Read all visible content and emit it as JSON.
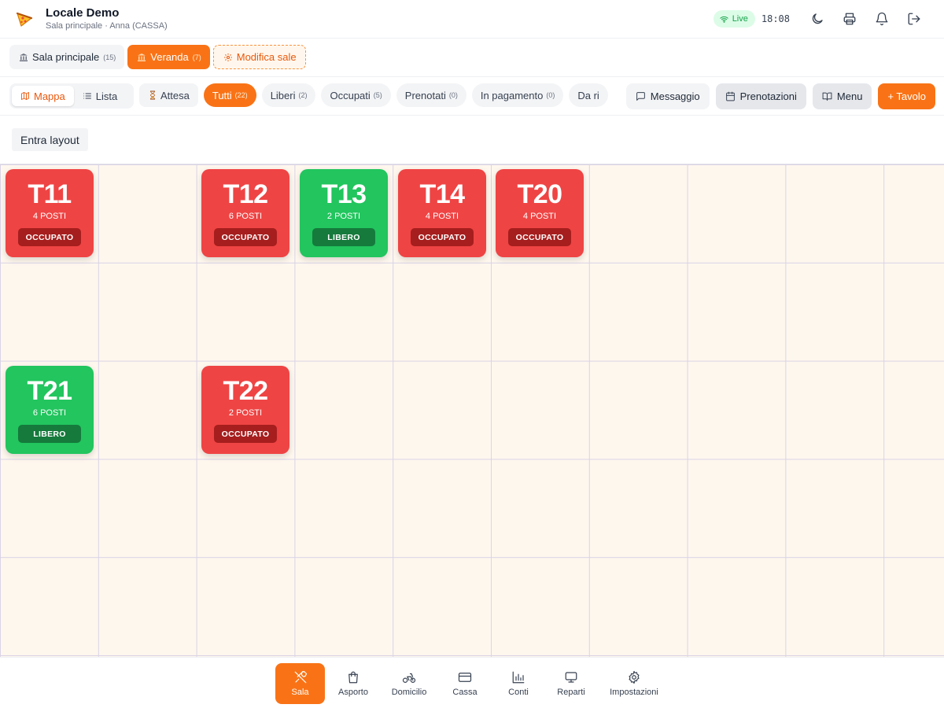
{
  "header": {
    "title": "Locale Demo",
    "subtitle": "Sala principale · Anna (CASSA)",
    "live_label": "Live",
    "time": "18:08"
  },
  "rooms": [
    {
      "label": "Sala principale",
      "count": "(15)"
    },
    {
      "label": "Veranda",
      "count": "(7)"
    },
    {
      "label": "Modifica sale"
    }
  ],
  "view_toggle": {
    "map_label": "Mappa",
    "list_label": "Lista"
  },
  "filters": {
    "wait_label": "Attesa",
    "items": [
      {
        "label": "Tutti",
        "count": "(22)"
      },
      {
        "label": "Liberi",
        "count": "(2)"
      },
      {
        "label": "Occupati",
        "count": "(5)"
      },
      {
        "label": "Prenotati",
        "count": "(0)"
      },
      {
        "label": "In pagamento",
        "count": "(0)"
      },
      {
        "label": "Da ri",
        "count": ""
      }
    ]
  },
  "actions": {
    "message_label": "Messaggio",
    "reservations_label": "Prenotazioni",
    "menu_label": "Menu",
    "add_table_label": "+ Tavolo"
  },
  "layout_button": "Entra layout",
  "tables": [
    {
      "name": "T11",
      "seats": "4 POSTI",
      "status": "OCCUPATO"
    },
    {
      "name": "T12",
      "seats": "6 POSTI",
      "status": "OCCUPATO"
    },
    {
      "name": "T13",
      "seats": "2 POSTI",
      "status": "LIBERO"
    },
    {
      "name": "T14",
      "seats": "4 POSTI",
      "status": "OCCUPATO"
    },
    {
      "name": "T20",
      "seats": "4 POSTI",
      "status": "OCCUPATO"
    },
    {
      "name": "T21",
      "seats": "6 POSTI",
      "status": "LIBERO"
    },
    {
      "name": "T22",
      "seats": "2 POSTI",
      "status": "OCCUPATO"
    }
  ],
  "bottom_nav": [
    {
      "label": "Sala"
    },
    {
      "label": "Asporto"
    },
    {
      "label": "Domicilio"
    },
    {
      "label": "Cassa"
    },
    {
      "label": "Conti"
    },
    {
      "label": "Reparti"
    },
    {
      "label": "Impostazioni"
    }
  ],
  "colors": {
    "accent": "#f97316",
    "occupied": "#ef4444",
    "free": "#22c55e",
    "grid_bg": "#fef7ee"
  }
}
